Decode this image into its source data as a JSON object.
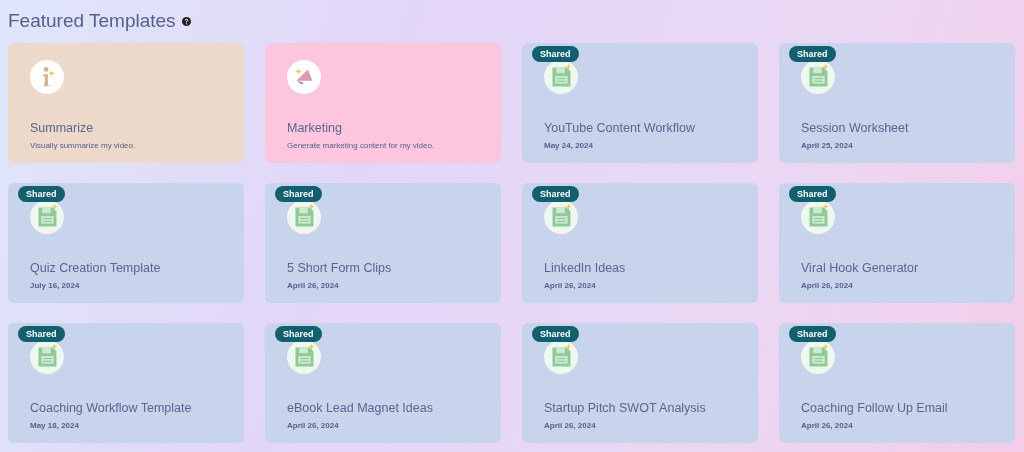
{
  "heading": {
    "title": "Featured Templates"
  },
  "cards": [
    {
      "kind": "info",
      "color": "#ecd9c9",
      "shared": false,
      "title": "Summarize",
      "subtitle": "Visually summarize my video."
    },
    {
      "kind": "marketing",
      "color": "#fcc6de",
      "shared": false,
      "title": "Marketing",
      "subtitle": "Generate marketing content for my video."
    },
    {
      "kind": "file",
      "color": "#c8d3ec",
      "shared": true,
      "badge": "Shared",
      "title": "YouTube Content Workflow",
      "subtitle": "May 24, 2024"
    },
    {
      "kind": "file",
      "color": "#c8d3ec",
      "shared": true,
      "badge": "Shared",
      "title": "Session Worksheet",
      "subtitle": "April 25, 2024"
    },
    {
      "kind": "file",
      "color": "#c8d3ec",
      "shared": true,
      "badge": "Shared",
      "title": "Quiz Creation Template",
      "subtitle": "July 16, 2024"
    },
    {
      "kind": "file",
      "color": "#c8d3ec",
      "shared": true,
      "badge": "Shared",
      "title": "5 Short Form Clips",
      "subtitle": "April 26, 2024"
    },
    {
      "kind": "file",
      "color": "#c8d3ec",
      "shared": true,
      "badge": "Shared",
      "title": "LinkedIn Ideas",
      "subtitle": "April 26, 2024"
    },
    {
      "kind": "file",
      "color": "#c8d3ec",
      "shared": true,
      "badge": "Shared",
      "title": "Viral Hook Generator",
      "subtitle": "April 26, 2024"
    },
    {
      "kind": "file",
      "color": "#c8d3ec",
      "shared": true,
      "badge": "Shared",
      "title": "Coaching Workflow Template",
      "subtitle": "May 18, 2024"
    },
    {
      "kind": "file",
      "color": "#c8d3ec",
      "shared": true,
      "badge": "Shared",
      "title": "eBook Lead Magnet Ideas",
      "subtitle": "April 26, 2024"
    },
    {
      "kind": "file",
      "color": "#c8d3ec",
      "shared": true,
      "badge": "Shared",
      "title": "Startup Pitch SWOT Analysis",
      "subtitle": "April 26, 2024"
    },
    {
      "kind": "file",
      "color": "#c8d3ec",
      "shared": true,
      "badge": "Shared",
      "title": "Coaching Follow Up Email",
      "subtitle": "April 26, 2024"
    }
  ]
}
